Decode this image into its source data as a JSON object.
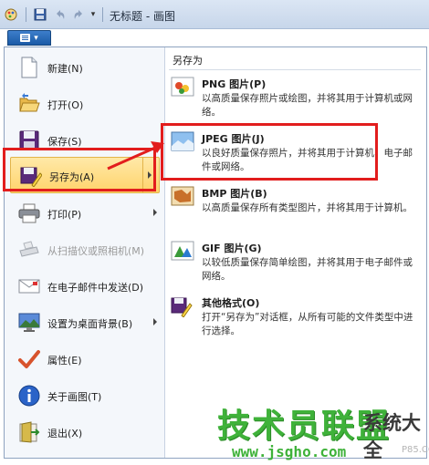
{
  "titlebar": {
    "title": "无标题 - 画图",
    "more_glyph": "▾"
  },
  "app_menu_button": {
    "caret": "▾"
  },
  "menu": {
    "items": [
      {
        "label": "新建(N)",
        "icon": "new-doc-icon"
      },
      {
        "label": "打开(O)",
        "icon": "open-folder-icon"
      },
      {
        "label": "保存(S)",
        "icon": "floppy-save-icon"
      },
      {
        "label": "另存为(A)",
        "icon": "save-as-icon",
        "active": true,
        "submenu": true
      },
      {
        "label": "打印(P)",
        "icon": "printer-icon",
        "submenu": true
      },
      {
        "label": "从扫描仪或照相机(M)",
        "icon": "scanner-icon",
        "disabled": true
      },
      {
        "label": "在电子邮件中发送(D)",
        "icon": "email-icon"
      },
      {
        "label": "设置为桌面背景(B)",
        "icon": "desktop-background-icon",
        "submenu": true
      },
      {
        "label": "属性(E)",
        "icon": "checkmark-properties-icon"
      },
      {
        "label": "关于画图(T)",
        "icon": "info-icon"
      },
      {
        "label": "退出(X)",
        "icon": "exit-icon"
      }
    ]
  },
  "save_as": {
    "title": "另存为",
    "formats": [
      {
        "name": "PNG 图片(P)",
        "desc": "以高质量保存照片或绘图，并将其用于计算机或网络。",
        "icon": "png-picture-icon"
      },
      {
        "name": "JPEG 图片(J)",
        "desc": "以良好质量保存照片，并将其用于计算机、电子邮件或网络。",
        "icon": "jpeg-landscape-icon"
      },
      {
        "name": "BMP 图片(B)",
        "desc": "以高质量保存所有类型图片，并将其用于计算机。",
        "icon": "bmp-picture-icon"
      },
      {
        "name": "GIF 图片(G)",
        "desc": "以较低质量保存简单绘图，并将其用于电子邮件或网络。",
        "icon": "gif-picture-icon"
      },
      {
        "name": "其他格式(O)",
        "desc": "打开“另存为”对话框，从所有可能的文件类型中进行选择。",
        "icon": "other-formats-icon"
      }
    ]
  },
  "watermark": {
    "big": "技术员联盟",
    "small": "系统大全",
    "url": "www.jsgho.com",
    "faint": "P85.COM"
  },
  "colors": {
    "highlight_border": "#e21d1d",
    "active_item": "#ffd36b",
    "watermark_green": "#3fb23a"
  }
}
